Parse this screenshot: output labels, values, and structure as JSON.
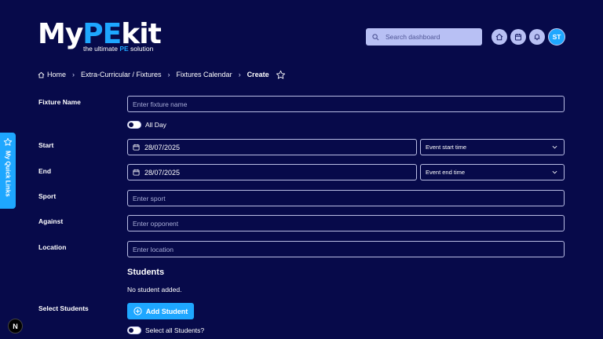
{
  "logo": {
    "part1": "My",
    "part2": "PE",
    "part3": "kit",
    "tagline_pre": "the ultimate ",
    "tagline_mid": "PE",
    "tagline_post": " solution"
  },
  "header": {
    "search_placeholder": "Search dashboard",
    "buttons": [
      "home-icon",
      "calendar-icon",
      "bell-icon"
    ],
    "avatar_initials": "ST"
  },
  "breadcrumb": {
    "items": [
      "Home",
      "Extra-Curricular / Fixtures",
      "Fixtures Calendar"
    ],
    "current": "Create"
  },
  "form": {
    "fixture_name": {
      "label": "Fixture Name",
      "placeholder": "Enter fixture name",
      "value": ""
    },
    "all_day": {
      "label": "All Day",
      "checked": false
    },
    "start": {
      "label": "Start",
      "date": "28/07/2025",
      "time_placeholder": "Event start time"
    },
    "end": {
      "label": "End",
      "date": "28/07/2025",
      "time_placeholder": "Event end time"
    },
    "sport": {
      "label": "Sport",
      "placeholder": "Enter sport",
      "value": ""
    },
    "against": {
      "label": "Against",
      "placeholder": "Enter opponent",
      "value": ""
    },
    "location": {
      "label": "Location",
      "placeholder": "Enter location",
      "value": ""
    }
  },
  "students": {
    "title": "Students",
    "empty_text": "No student added.",
    "select_label": "Select Students",
    "add_button": "Add Student",
    "select_all": {
      "label": "Select all Students?",
      "checked": false
    }
  },
  "quick_links": {
    "label": "My Quick Links"
  },
  "dev_badge": "N",
  "colors": {
    "background": "#070a4a",
    "accent": "#1ea7ff",
    "control_bg": "#b8c0f4"
  }
}
